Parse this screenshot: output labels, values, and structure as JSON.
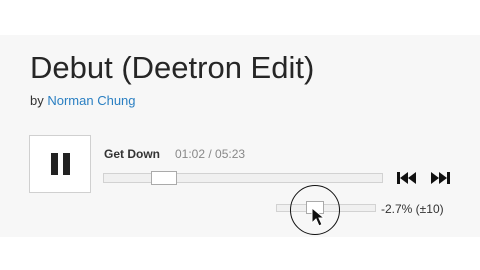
{
  "song": {
    "title": "Debut (Deetron Edit)",
    "by_prefix": "by",
    "artist": "Norman Chung"
  },
  "player": {
    "state": "playing",
    "toggle_icon": "pause-icon",
    "track_name": "Get Down",
    "time_display": "01:02 / 05:23",
    "progress": 0.19,
    "prev_icon": "skip-previous-icon",
    "next_icon": "skip-next-icon"
  },
  "pitch": {
    "value_label": "-2.7% (±10)",
    "level": 0.365
  },
  "pointer": {
    "icon": "cursor-arrow-icon",
    "highlight": "click-highlight-ring"
  },
  "colors": {
    "artist_link": "#2a7fc2",
    "panel_background": "#f7f7f7",
    "title_text": "#262626"
  }
}
